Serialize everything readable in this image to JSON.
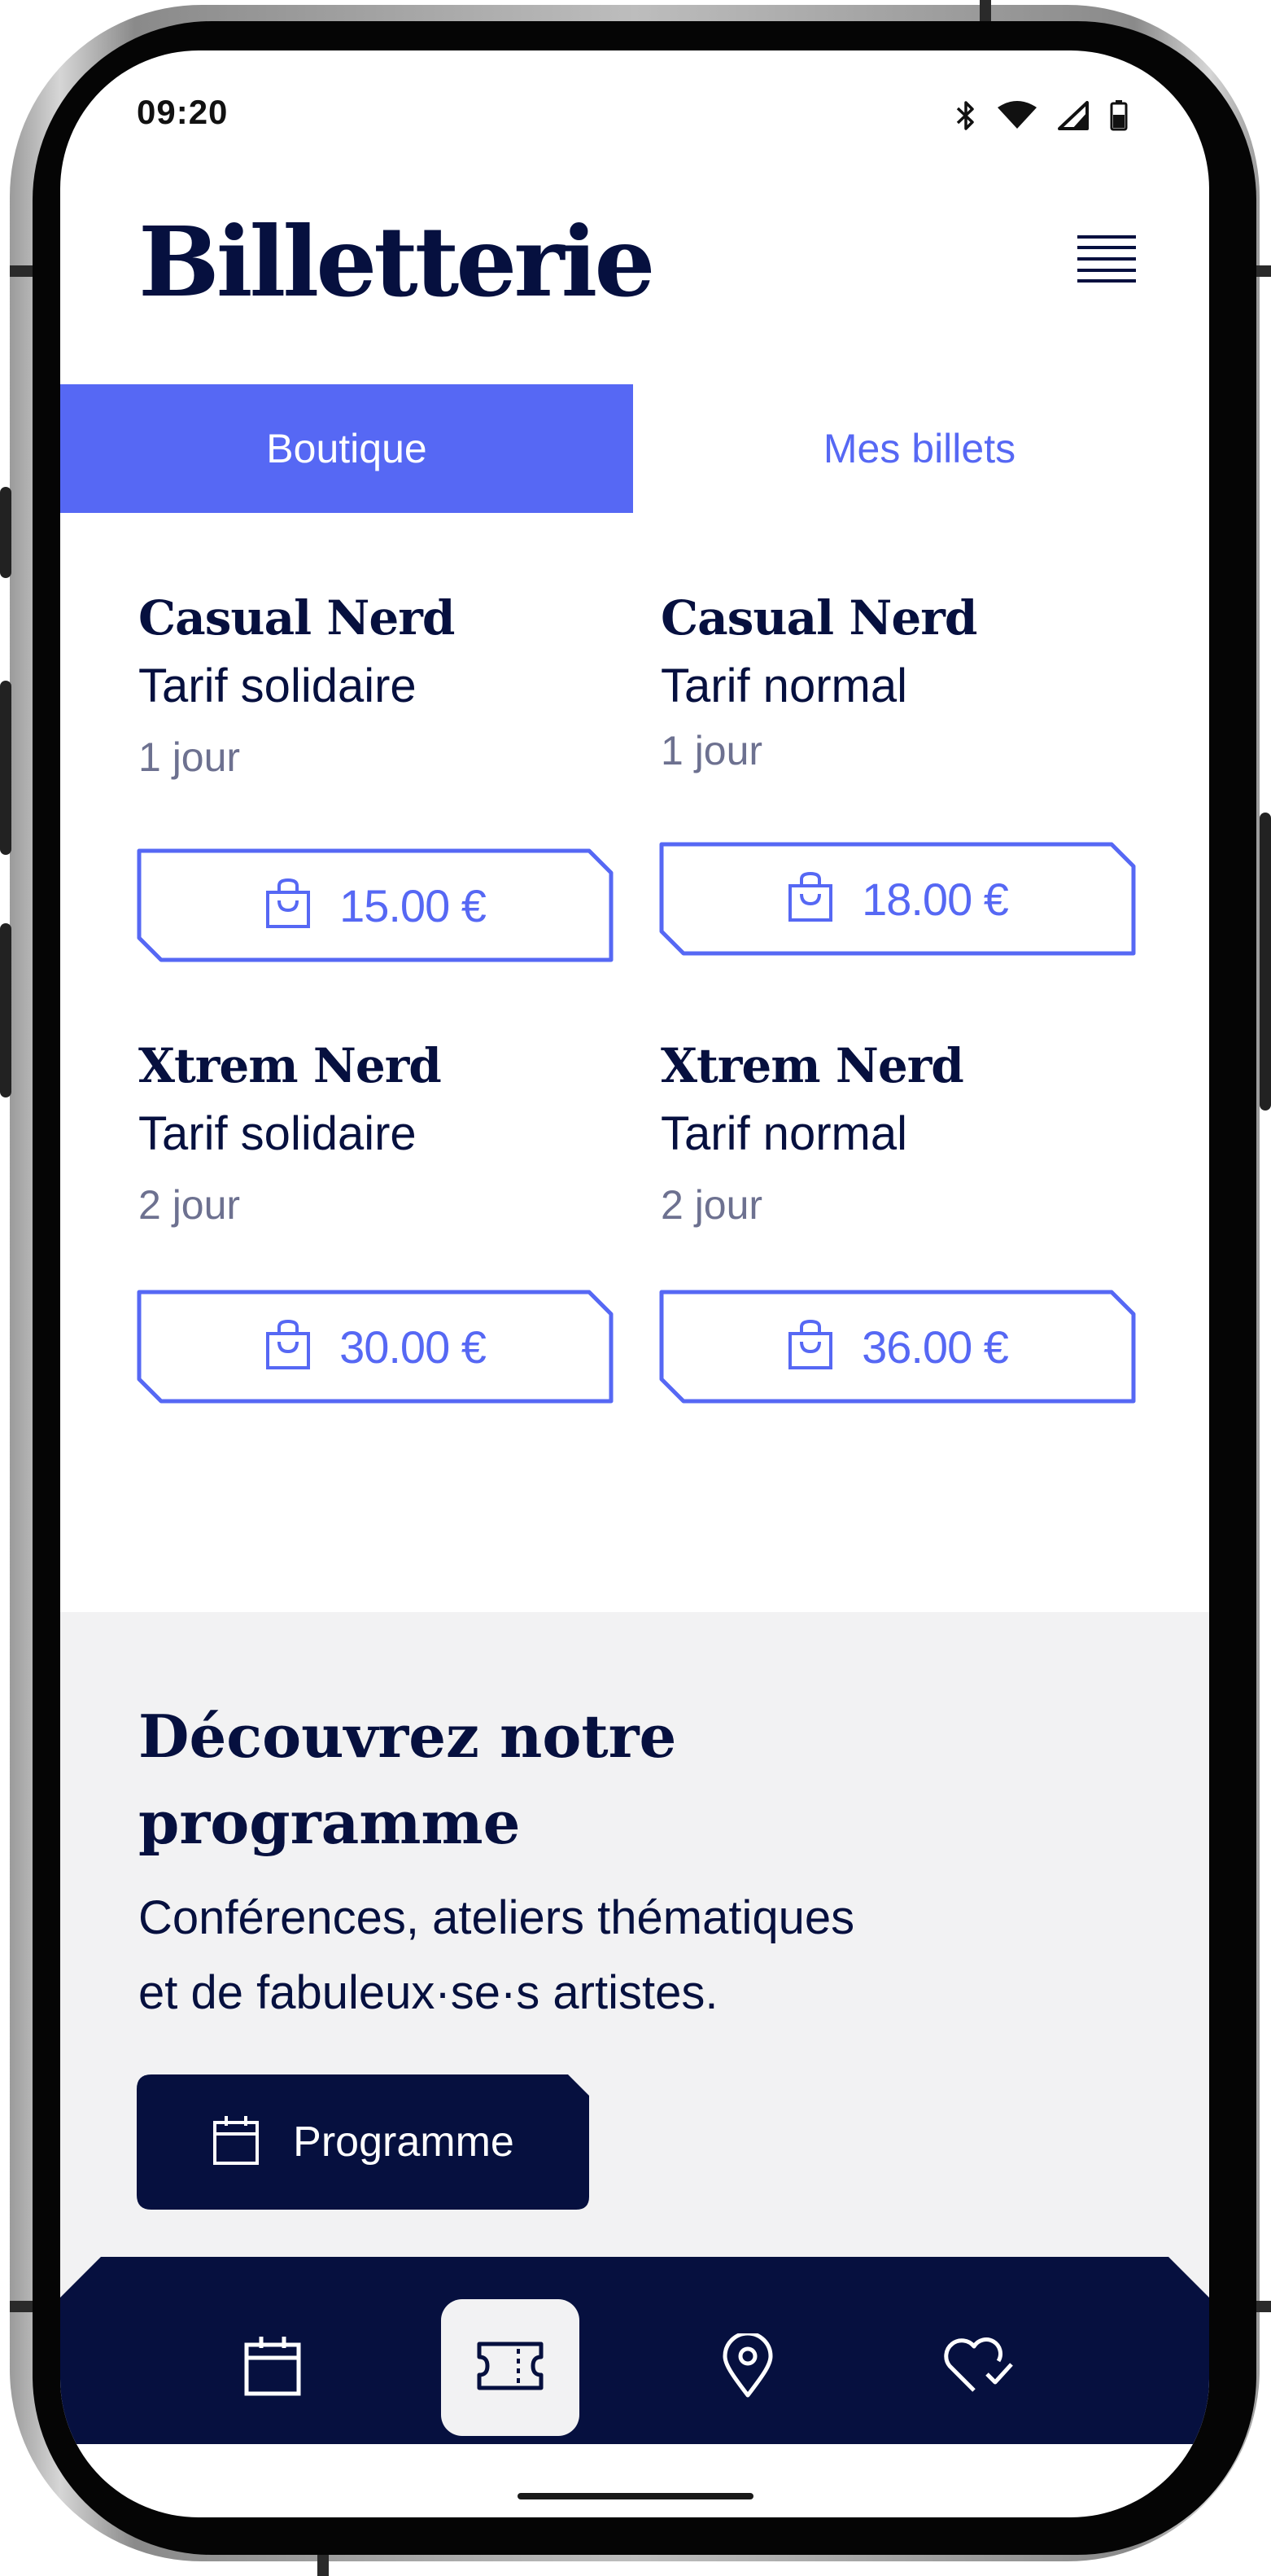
{
  "status_bar": {
    "time": "09:20",
    "icons": [
      "bluetooth-icon",
      "wifi-icon",
      "cellular-signal-icon",
      "battery-icon"
    ]
  },
  "header": {
    "title": "Billetterie",
    "menu_icon": "hamburger-menu-icon"
  },
  "tabs": [
    {
      "label": "Boutique",
      "active": true
    },
    {
      "label": "Mes billets",
      "active": false
    }
  ],
  "products": [
    {
      "name": "Casual Nerd",
      "tarif": "Tarif solidaire",
      "duration": "1 jour",
      "price": "15.00 €",
      "icon": "shopping-bag-icon"
    },
    {
      "name": "Casual Nerd",
      "tarif": "Tarif normal",
      "duration": "1 jour",
      "price": "18.00 €",
      "icon": "shopping-bag-icon"
    },
    {
      "name": "Xtrem Nerd",
      "tarif": "Tarif solidaire",
      "duration": "2 jour",
      "price": "30.00 €",
      "icon": "shopping-bag-icon"
    },
    {
      "name": "Xtrem Nerd",
      "tarif": "Tarif normal",
      "duration": "2 jour",
      "price": "36.00 €",
      "icon": "shopping-bag-icon"
    }
  ],
  "program": {
    "title_line1": "Découvrez notre",
    "title_line2": "programme",
    "desc_line1": "Conférences, ateliers thématiques",
    "desc_line2": "et de fabuleux·se·s artistes.",
    "button_label": "Programme",
    "button_icon": "calendar-icon"
  },
  "bottom_nav": {
    "items": [
      {
        "icon": "calendar-icon",
        "active": false
      },
      {
        "icon": "ticket-icon",
        "active": true
      },
      {
        "icon": "map-pin-icon",
        "active": false
      },
      {
        "icon": "heart-check-icon",
        "active": false
      }
    ]
  },
  "colors": {
    "accent": "#5668f4",
    "navy": "#06103f",
    "muted_text": "#6d7190",
    "section_bg": "#f2f2f3"
  }
}
